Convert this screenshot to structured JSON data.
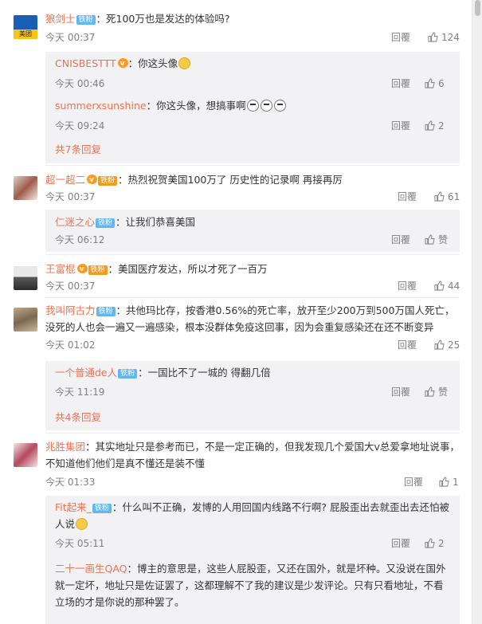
{
  "comments": [
    {
      "name": "狼剑士",
      "badge": "铁粉",
      "text": "：死100万也是发达的体验吗?",
      "time": "今天 00:37",
      "reply": "回覆",
      "likes": "124"
    },
    {
      "name": "超一超二",
      "badge": "铁粉",
      "text": "：热烈祝贺美国100万了 历史性的记录啊 再接再厉",
      "time": "今天 00:37",
      "reply": "回覆",
      "likes": "61"
    },
    {
      "name": "王富棍",
      "badge": "铁粉",
      "text": "：美国医疗发达，所以才死了一百万",
      "time": "今天 00:37",
      "reply": "回覆",
      "likes": "44"
    },
    {
      "name": "我叫阿古力",
      "badge": "铁粉",
      "text": "：共他玛比存，按香港0.56%的死亡率，放开至少200万到500万国人死亡，没死的人也会一遍又一遍感染，根本没群体免疫这回事，因为会重复感染还在还不断变异",
      "time": "今天 01:02",
      "reply": "回覆",
      "likes": "25"
    },
    {
      "name": "兆胜集团",
      "text": "：其实地址只是参考而已，不是一定正确的，但我发现几个爱国大v总爱拿地址说事，不知道他们他们是真不懂还是装不懂",
      "time": "今天 01:33",
      "reply": "回覆",
      "likes": "1"
    }
  ],
  "subs": [
    {
      "name": "CNISBESTTT",
      "text": "：你这头像",
      "time": "今天 00:46",
      "reply": "回覆",
      "likes": "6"
    },
    {
      "name": "summerxsunshine",
      "text": "：你这头像，想搞事啊",
      "time": "今天 09:24",
      "reply": "回覆",
      "likes": "2"
    },
    {
      "name": "仁迷之心",
      "badge": "铁粉",
      "text": "：让我们恭喜美国",
      "time": "今天 06:12",
      "reply": "回覆",
      "likes": "赞"
    },
    {
      "name": "一个普通de人",
      "badge": "铁粉",
      "text": "：一国比不了一城的 得翻几倍",
      "time": "今天 11:19",
      "reply": "回覆",
      "likes": "赞"
    },
    {
      "name": "Fit起来_",
      "badge": "铁粉",
      "text": "：什么叫不正确，发博的人用回国内线路不行啊? 屁股歪出去就歪出去还怕被人说",
      "time": "今天 05:11",
      "reply": "回覆",
      "likes": "2"
    },
    {
      "name": "二十一画生QAQ",
      "text": "：博主的意思是，这些人屁股歪，又还在国外，就是坏种。又没说在国外就一定坏，地址只是佐证罢了，这都理解不了我的建议是少发评论。只有只看地址，不看立场的才是你说的那种罢了。"
    }
  ],
  "more": [
    "共7条回复",
    "共4条回复"
  ],
  "avatar_text": "美团"
}
